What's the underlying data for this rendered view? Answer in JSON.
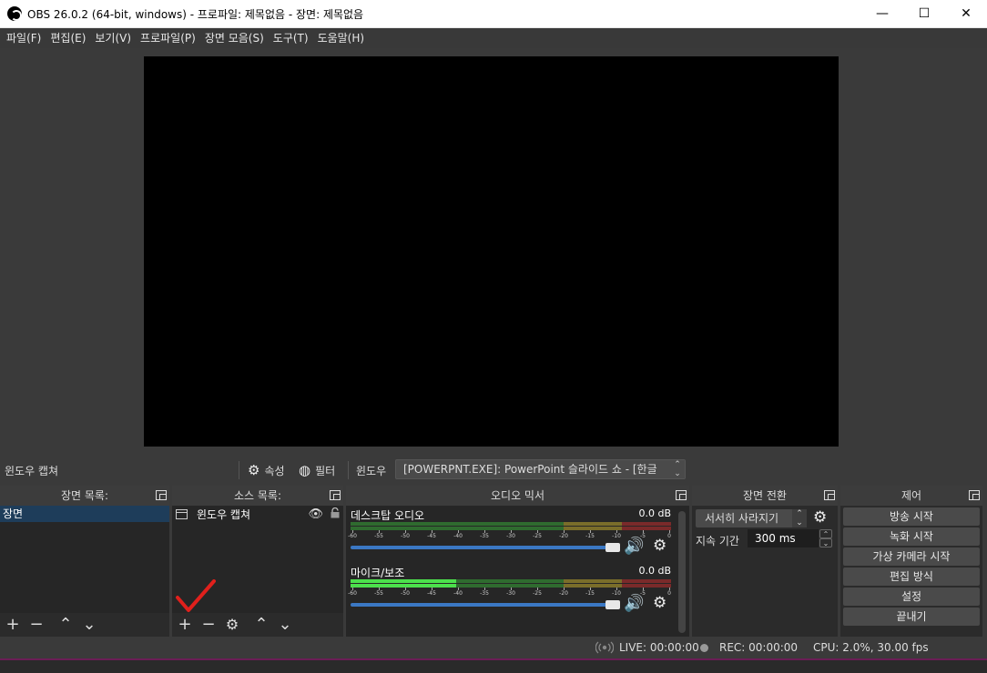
{
  "window": {
    "title": "OBS 26.0.2 (64-bit, windows) - 프로파일: 제목없음 - 장면: 제목없음",
    "minimize": "—",
    "maximize": "☐",
    "close": "✕"
  },
  "menu": [
    "파일(F)",
    "편집(E)",
    "보기(V)",
    "프로파일(P)",
    "장면 모음(S)",
    "도구(T)",
    "도움말(H)"
  ],
  "context_bar": {
    "source_name": "윈도우 캡쳐",
    "properties_label": "속성",
    "filters_label": "필터",
    "window_label": "윈도우",
    "window_value": "[POWERPNT.EXE]: PowerPoint 슬라이드 쇼 - [한글"
  },
  "scenes": {
    "header": "장면 목록:",
    "items": [
      "장면"
    ]
  },
  "sources": {
    "header": "소스 목록:",
    "items": [
      "윈도우 캡쳐"
    ]
  },
  "mixer": {
    "header": "오디오 믹서",
    "channels": [
      {
        "name": "데스크탑 오디오",
        "db": "0.0 dB",
        "level_fraction": 0.0
      },
      {
        "name": "마이크/보조",
        "db": "0.0 dB",
        "level_fraction": 0.33
      }
    ],
    "tick_labels": [
      "-60",
      "-55",
      "-50",
      "-45",
      "-40",
      "-35",
      "-30",
      "-25",
      "-20",
      "-15",
      "-10",
      "-5",
      "0"
    ]
  },
  "transitions": {
    "header": "장면 전환",
    "selected": "서서히 사라지기",
    "duration_label": "지속 기간",
    "duration_value": "300 ms"
  },
  "controls": {
    "header": "제어",
    "buttons": [
      "방송 시작",
      "녹화 시작",
      "가상 카메라 시작",
      "편집 방식",
      "설정",
      "끝내기"
    ]
  },
  "status": {
    "live": "LIVE: 00:00:00",
    "rec": "REC: 00:00:00",
    "cpu": "CPU: 2.0%, 30.00 fps"
  },
  "colors": {
    "annotation_check": "#e0201c",
    "selected_row": "#1e3d5a",
    "meter_active": "#4ce04c",
    "slider": "#3b78c4"
  }
}
